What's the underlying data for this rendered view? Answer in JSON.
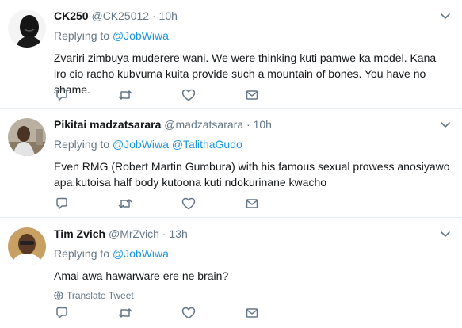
{
  "tweets": [
    {
      "name": "CK250",
      "handle": "@CK25012",
      "dot": "·",
      "time": "10h",
      "replying_prefix": "Replying to ",
      "replying_to": [
        "@JobWiwa"
      ],
      "text": "Zvariri zimbuya muderere wani. We were thinking kuti pamwe ka model. Kana iro cio racho kubvuma kuita provide such a mountain of bones. You have no shame."
    },
    {
      "name": "Pikitai madzatsarara",
      "handle": "@madzatsarara",
      "dot": "·",
      "time": "10h",
      "replying_prefix": "Replying to ",
      "replying_to": [
        "@JobWiwa",
        "@TalithaGudo"
      ],
      "text": "Even RMG (Robert Martin Gumbura) with his famous sexual prowess anosiyawo apa.kutoisa half body kutoona kuti ndokurinane kwacho"
    },
    {
      "name": "Tim Zvich",
      "handle": "@MrZvich",
      "dot": "·",
      "time": "13h",
      "replying_prefix": "Replying to ",
      "replying_to": [
        "@JobWiwa"
      ],
      "text": "Amai awa hawarware ere ne brain?",
      "translate": "Translate Tweet"
    }
  ],
  "icons": {
    "reply": "reply-icon",
    "retweet": "retweet-icon",
    "like": "heart-icon",
    "dm": "envelope-icon",
    "more": "chevron-down-icon",
    "translate": "globe-icon"
  },
  "colors": {
    "link": "#1b95e0",
    "muted": "#657786",
    "text": "#14171a",
    "divider": "#e6ecf0"
  }
}
